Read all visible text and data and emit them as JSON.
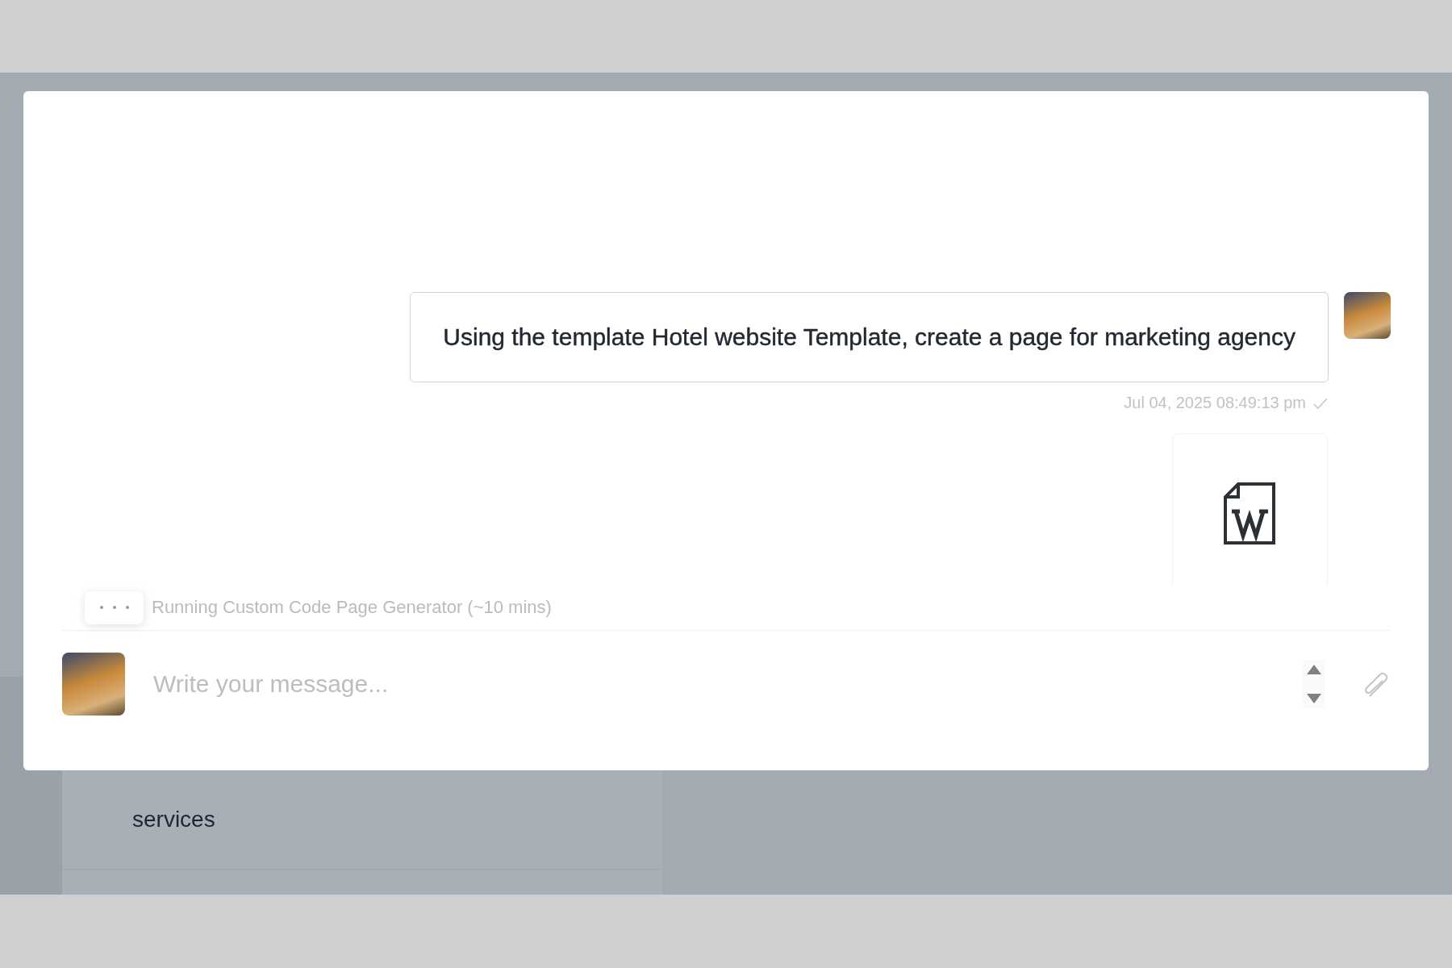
{
  "chat": {
    "messages": [
      {
        "text": "Using the template Hotel website Template, create a page for marketing agency",
        "timestamp": "Jul 04, 2025 08:49:13 pm",
        "delivered": true
      }
    ],
    "attachment": {
      "kind": "word"
    },
    "status": {
      "text": "Running Custom Code Page Generator (~10 mins)"
    },
    "composer": {
      "placeholder": "Write your message..."
    }
  },
  "background": {
    "list_items": [
      "services"
    ]
  }
}
